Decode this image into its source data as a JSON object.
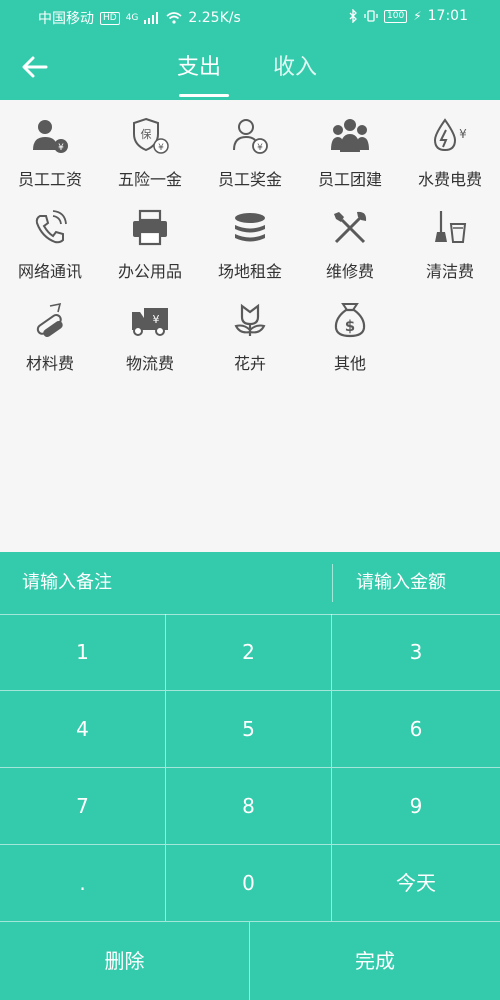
{
  "status_bar": {
    "carrier": "中国移动",
    "network_badge": "HD",
    "signal": "4G",
    "speed": "2.25K/s",
    "battery": "100",
    "time": "17:01"
  },
  "header": {
    "back_icon": "arrow-left-icon",
    "tabs": [
      {
        "label": "支出",
        "active": true
      },
      {
        "label": "收入",
        "active": false
      }
    ]
  },
  "categories": [
    {
      "label": "员工工资",
      "icon": "employee-salary-icon"
    },
    {
      "label": "五险一金",
      "icon": "insurance-icon"
    },
    {
      "label": "员工奖金",
      "icon": "employee-bonus-icon"
    },
    {
      "label": "员工团建",
      "icon": "team-building-icon"
    },
    {
      "label": "水费电费",
      "icon": "utilities-icon"
    },
    {
      "label": "网络通讯",
      "icon": "phone-icon"
    },
    {
      "label": "办公用品",
      "icon": "printer-icon"
    },
    {
      "label": "场地租金",
      "icon": "coins-icon"
    },
    {
      "label": "维修费",
      "icon": "tools-icon"
    },
    {
      "label": "清洁费",
      "icon": "cleaning-icon"
    },
    {
      "label": "材料费",
      "icon": "materials-icon"
    },
    {
      "label": "物流费",
      "icon": "truck-icon"
    },
    {
      "label": "花卉",
      "icon": "flower-icon"
    },
    {
      "label": "其他",
      "icon": "money-bag-icon"
    }
  ],
  "keypad": {
    "note_placeholder": "请输入备注",
    "amount_placeholder": "请输入金额",
    "keys": [
      "1",
      "2",
      "3",
      "4",
      "5",
      "6",
      "7",
      "8",
      "9",
      ".",
      "0",
      "今天"
    ],
    "delete_label": "删除",
    "done_label": "完成"
  },
  "colors": {
    "accent": "#34cbad",
    "icon": "#5a5a5a",
    "text": "#333333"
  }
}
